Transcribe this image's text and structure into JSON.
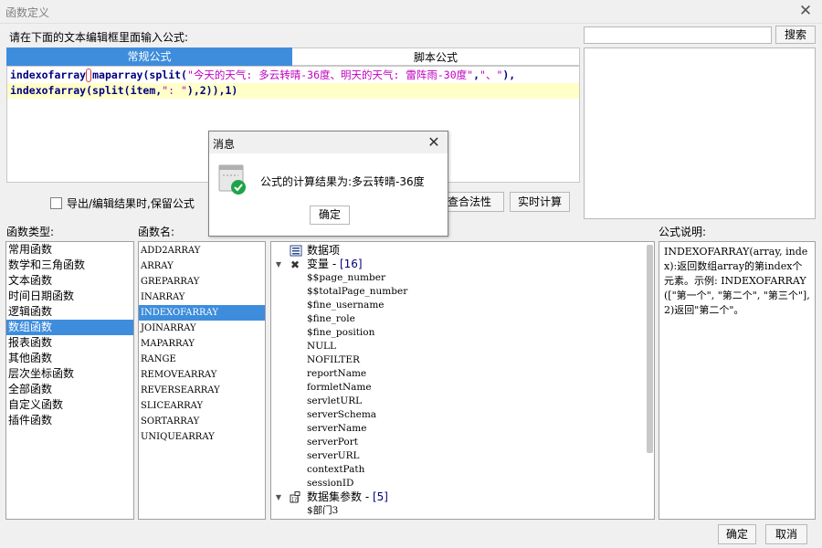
{
  "window": {
    "title": "函数定义"
  },
  "prompt": "请在下面的文本编辑框里面输入公式:",
  "tabs": [
    "常规公式",
    "脚本公式"
  ],
  "editor": {
    "line1": {
      "fn1": "indexofarray",
      "open1": "(",
      "fn2": "maparray",
      "open2": "(",
      "fn3": "split",
      "open3": "(",
      "str1": "\"今天的天气: 多云转晴-36度、明天的天气: 雷阵雨-30度\"",
      "comma1": ",",
      "str2": "\"、\"",
      "close": "),"
    },
    "line2": {
      "fn1": "indexofarray",
      "open1": "(",
      "fn2": "split",
      "rest1": "(item,",
      "str1": "\": \"",
      "rest2": "),2)),1)"
    }
  },
  "search": {
    "value": "",
    "button": "搜索"
  },
  "options": {
    "keep_formula": "导出/编辑结果时,保留公式",
    "check_button": "查合法性",
    "calc_button": "实时计算"
  },
  "labels": {
    "types": "函数类型:",
    "names": "函数名:",
    "description": "公式说明:"
  },
  "function_types": [
    "常用函数",
    "数学和三角函数",
    "文本函数",
    "时间日期函数",
    "逻辑函数",
    "数组函数",
    "报表函数",
    "其他函数",
    "层次坐标函数",
    "全部函数",
    "自定义函数",
    "插件函数"
  ],
  "function_types_selected": 5,
  "function_names": [
    "ADD2ARRAY",
    "ARRAY",
    "GREPARRAY",
    "INARRAY",
    "INDEXOFARRAY",
    "JOINARRAY",
    "MAPARRAY",
    "RANGE",
    "REMOVEARRAY",
    "REVERSEARRAY",
    "SLICEARRAY",
    "SORTARRAY",
    "UNIQUEARRAY"
  ],
  "function_names_selected": 4,
  "tree": {
    "data_items": "数据项",
    "variables": {
      "label": "变量 - ",
      "count": "[16]"
    },
    "variable_items": [
      "$$page_number",
      "$$totalPage_number",
      "$fine_username",
      "$fine_role",
      "$fine_position",
      "NULL",
      "NOFILTER",
      "reportName",
      "formletName",
      "servletURL",
      "serverSchema",
      "serverName",
      "serverPort",
      "serverURL",
      "contextPath",
      "sessionID"
    ],
    "dataset_params": {
      "label": "数据集参数 - ",
      "count": "[5]"
    },
    "dataset_items": [
      "$部门3"
    ]
  },
  "description": "INDEXOFARRAY(array, index):返回数组array的第index个元素。示例: INDEXOFARRAY([\"第一个\", \"第二个\", \"第三个\"], 2)返回\"第二个\"。",
  "footer": {
    "ok": "确定",
    "cancel": "取消"
  },
  "message": {
    "title": "消息",
    "text": "公式的计算结果为:多云转晴-36度",
    "ok": "确定"
  },
  "colors": {
    "accent": "#3e8ddd",
    "keyword": "#000080",
    "string": "#c000c0",
    "highlight_line": "#ffffc8",
    "success": "#1fa34a"
  }
}
